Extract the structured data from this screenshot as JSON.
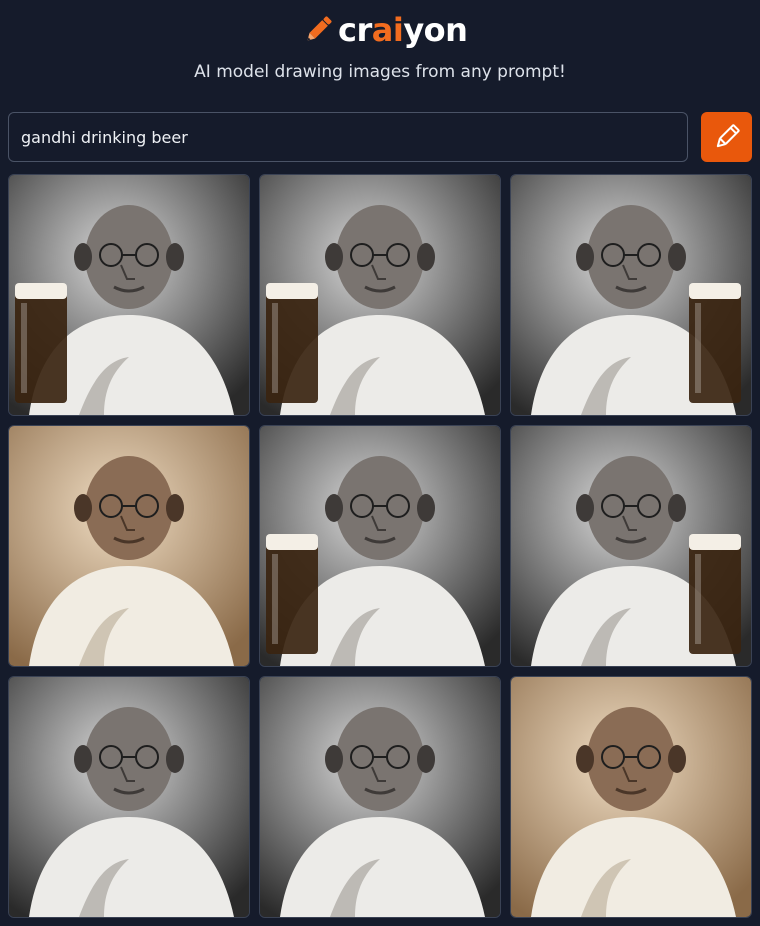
{
  "brand": {
    "name_prefix": "cr",
    "name_accent": "ai",
    "name_suffix": "yon",
    "accent_color": "#f26c1f",
    "logo_icon": "pencil-icon"
  },
  "tagline": "AI model drawing images from any prompt!",
  "search": {
    "value": "gandhi drinking beer",
    "button_icon": "pencil-icon",
    "button_color": "#e9580c"
  },
  "results": [
    {
      "tone": "bw",
      "beer": "left"
    },
    {
      "tone": "bw",
      "beer": "left"
    },
    {
      "tone": "bw",
      "beer": "right"
    },
    {
      "tone": "sepia",
      "beer": "none"
    },
    {
      "tone": "bw",
      "beer": "left"
    },
    {
      "tone": "bw",
      "beer": "right"
    },
    {
      "tone": "bw",
      "beer": "none"
    },
    {
      "tone": "bw",
      "beer": "none"
    },
    {
      "tone": "sepia",
      "beer": "none"
    }
  ]
}
